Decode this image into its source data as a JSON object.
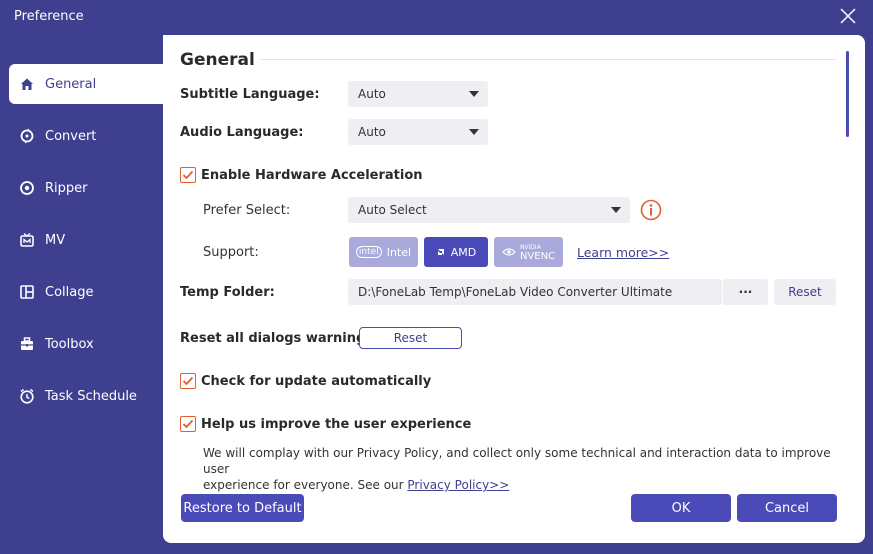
{
  "window": {
    "title": "Preference"
  },
  "sidebar": {
    "items": [
      {
        "label": "General",
        "icon": "home-icon",
        "active": true
      },
      {
        "label": "Convert",
        "icon": "convert-icon",
        "active": false
      },
      {
        "label": "Ripper",
        "icon": "ripper-icon",
        "active": false
      },
      {
        "label": "MV",
        "icon": "mv-icon",
        "active": false
      },
      {
        "label": "Collage",
        "icon": "collage-icon",
        "active": false
      },
      {
        "label": "Toolbox",
        "icon": "toolbox-icon",
        "active": false
      },
      {
        "label": "Task Schedule",
        "icon": "clock-icon",
        "active": false
      }
    ]
  },
  "general": {
    "title": "General",
    "subtitle_language": {
      "label": "Subtitle Language:",
      "value": "Auto"
    },
    "audio_language": {
      "label": "Audio Language:",
      "value": "Auto"
    },
    "hardware_acceleration": {
      "label": "Enable Hardware Acceleration",
      "checked": true
    },
    "prefer_select": {
      "label": "Prefer Select:",
      "value": "Auto Select"
    },
    "support": {
      "label": "Support:",
      "chips": [
        {
          "logo": "intel",
          "label": "Intel",
          "active": false
        },
        {
          "logo": "AMD",
          "label": "AMD",
          "active": true
        },
        {
          "logo": "NVIDIA",
          "label": "NVENC",
          "active": false
        }
      ],
      "learn_more": "Learn more>>"
    },
    "temp_folder": {
      "label": "Temp Folder:",
      "path": "D:\\FoneLab Temp\\FoneLab Video Converter Ultimate",
      "browse": "···",
      "reset": "Reset"
    },
    "reset_dialogs": {
      "label": "Reset all dialogs warnings:",
      "button": "Reset"
    },
    "check_update": {
      "label": "Check for update automatically",
      "checked": true
    },
    "improve_experience": {
      "label": "Help us improve the user experience",
      "checked": true,
      "text_line1": "We will complay with our Privacy Policy, and collect only some technical and interaction data to improve user",
      "text_line2": "experience for everyone. See our ",
      "policy_link": "Privacy Policy>>"
    }
  },
  "footer": {
    "restore": "Restore to Default",
    "ok": "OK",
    "cancel": "Cancel"
  },
  "colors": {
    "background": "#3f3f8f",
    "accent": "#4a4ab8",
    "checkbox": "#e06030"
  }
}
